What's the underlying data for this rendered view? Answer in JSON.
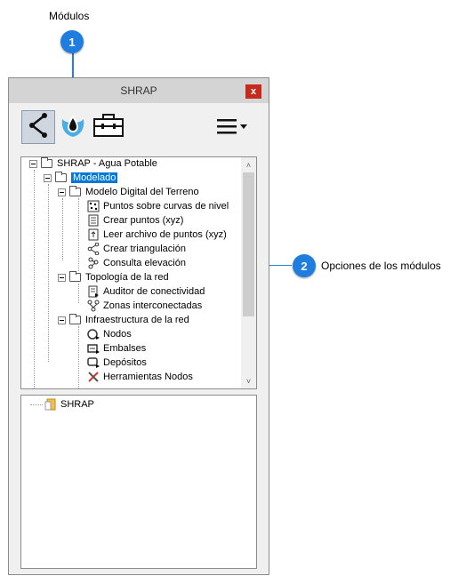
{
  "callouts": {
    "modules_label": "Módulos",
    "badge1": "1",
    "badge2": "2",
    "options_label": "Opciones de los módulos"
  },
  "window": {
    "title": "SHRAP",
    "close_label": "x"
  },
  "toolbar": {
    "buttons": [
      {
        "icon": "share-network-icon",
        "active": true
      },
      {
        "icon": "water-drop-icon",
        "active": false
      },
      {
        "icon": "toolbox-icon",
        "active": false
      }
    ],
    "menu_icon": "hamburger-menu-icon"
  },
  "tree": {
    "root": "SHRAP - Agua Potable",
    "modelado": "Modelado",
    "mdt": "Modelo Digital del Terreno",
    "mdt_items": [
      "Puntos sobre curvas de nivel",
      "Crear puntos (xyz)",
      "Leer archivo de puntos (xyz)",
      "Crear triangulación",
      "Consulta elevación"
    ],
    "topologia": "Topología de la red",
    "topologia_items": [
      "Auditor de conectividad",
      "Zonas interconectadas"
    ],
    "infra": "Infraestructura de la red",
    "infra_items": [
      "Nodos",
      "Embalses",
      "Depósitos",
      "Herramientas Nodos"
    ]
  },
  "bottom_tree": {
    "root": "SHRAP"
  },
  "colors": {
    "accent": "#1f7de0",
    "selection": "#0078d7",
    "close": "#c42b1c"
  }
}
